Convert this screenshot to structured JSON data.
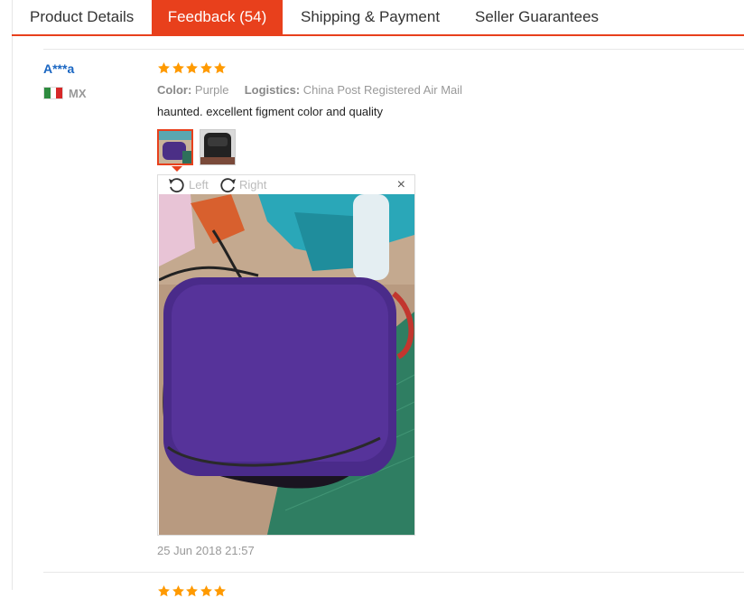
{
  "tabs": [
    {
      "label": "Product Details",
      "active": false
    },
    {
      "label": "Feedback (54)",
      "active": true
    },
    {
      "label": "Shipping & Payment",
      "active": false
    },
    {
      "label": "Seller Guarantees",
      "active": false
    }
  ],
  "review": {
    "user": "A***a",
    "country": "MX",
    "rating": 5,
    "color_label": "Color:",
    "color_value": "Purple",
    "logistics_label": "Logistics:",
    "logistics_value": "China Post Registered Air Mail",
    "text": "haunted. excellent figment color and quality",
    "viewer": {
      "rotate_left": "Left",
      "rotate_right": "Right",
      "close": "×"
    },
    "date": "25 Jun 2018 21:57"
  },
  "colors": {
    "accent": "#e8401c",
    "star": "#ff9a00",
    "username": "#1a66c2"
  },
  "icons": [
    "star-icon",
    "rotate-left-icon",
    "rotate-right-icon",
    "close-icon",
    "flag-mx-icon"
  ]
}
